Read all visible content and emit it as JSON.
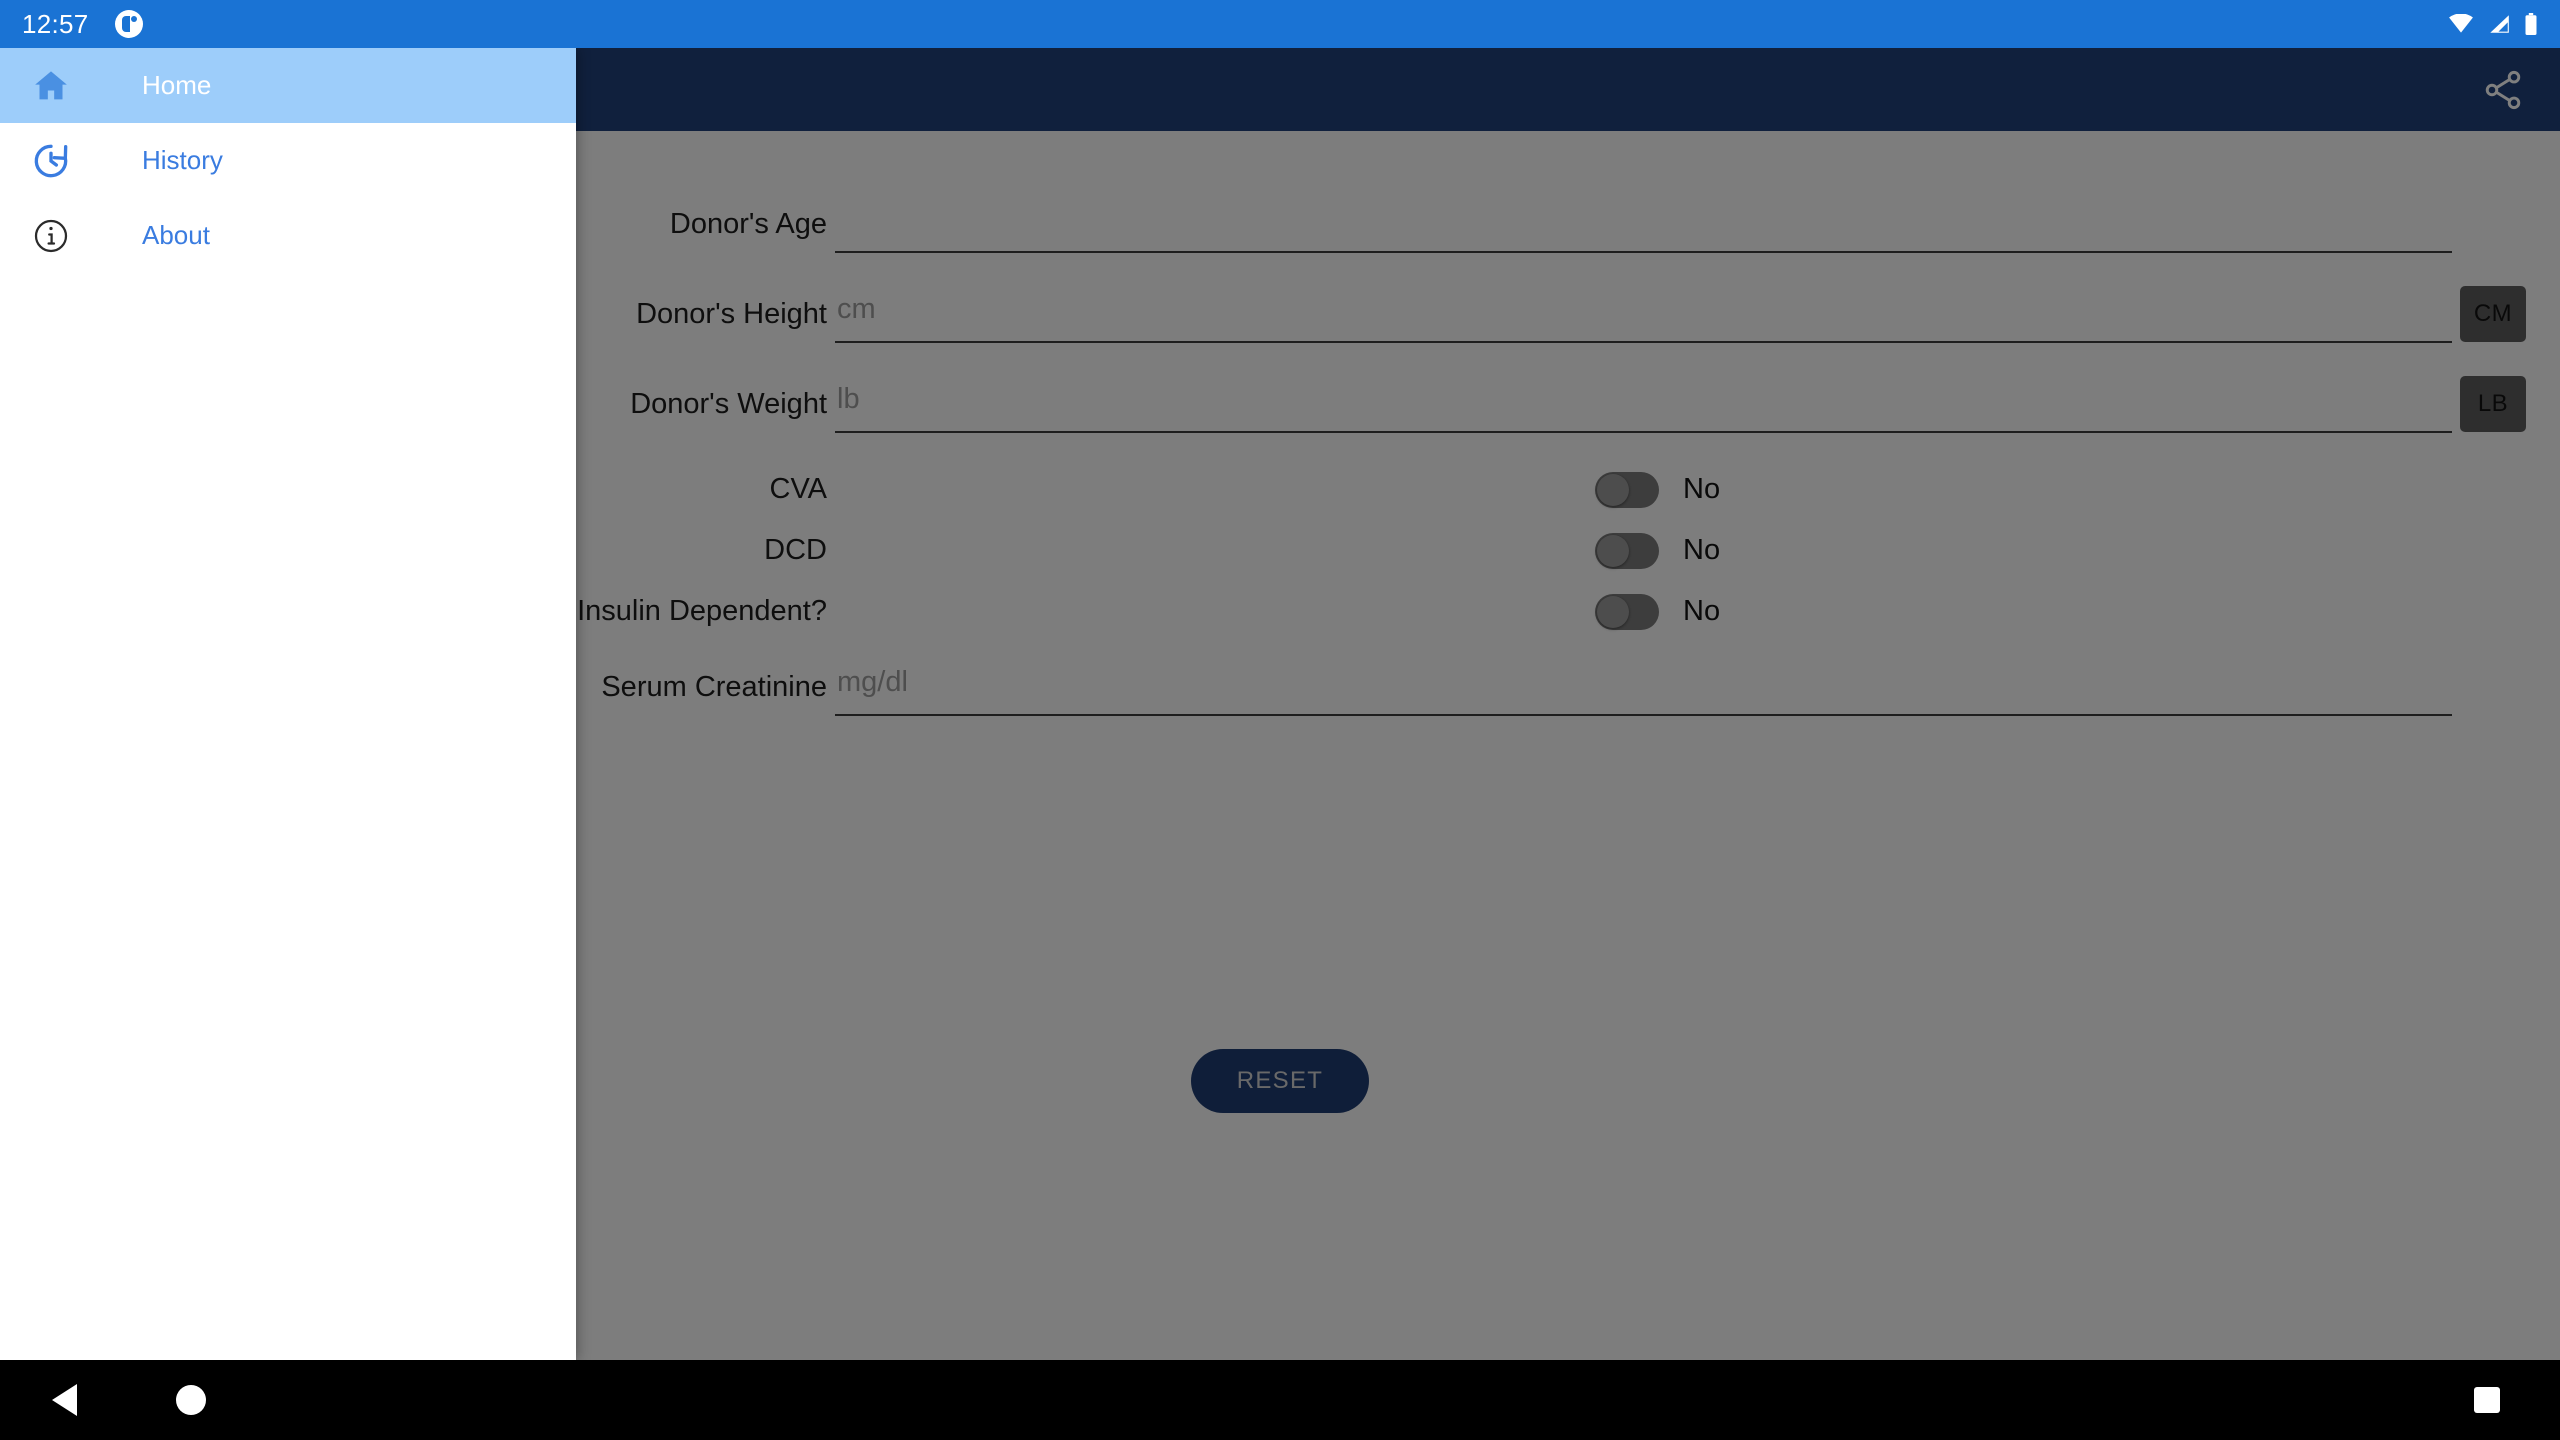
{
  "status_bar": {
    "clock": "12:57",
    "app_icon": "app-logo-icon",
    "icons": [
      "wifi-icon",
      "cellular-signal-icon",
      "battery-icon"
    ]
  },
  "app_bar": {
    "title": "",
    "share_icon": "share-icon"
  },
  "drawer": {
    "items": [
      {
        "label": "Home",
        "icon": "home-icon",
        "selected": true
      },
      {
        "label": "History",
        "icon": "history-icon",
        "selected": false
      },
      {
        "label": "About",
        "icon": "info-icon",
        "selected": false
      }
    ]
  },
  "form": {
    "fields": [
      {
        "label": "Donor's Age",
        "value": "",
        "placeholder": "",
        "unit_button": null
      },
      {
        "label": "Donor's Height",
        "value": "",
        "placeholder": "cm",
        "unit_button": "CM"
      },
      {
        "label": "Donor's Weight",
        "value": "",
        "placeholder": "lb",
        "unit_button": "LB"
      }
    ],
    "switches": [
      {
        "label": "CVA",
        "value": "No",
        "on": false
      },
      {
        "label": "DCD",
        "value": "No",
        "on": false
      },
      {
        "label": "Insulin Dependent?",
        "value": "No",
        "on": false
      }
    ],
    "creatinine": {
      "label": "Serum Creatinine",
      "value": "",
      "placeholder": "mg/dl"
    },
    "reset_label": "RESET"
  },
  "nav_bar": {
    "back": "back-triangle-icon",
    "home": "home-circle-icon",
    "recents": "recents-square-icon"
  },
  "colors": {
    "status_bar": "#1a73d4",
    "app_bar": "#21417a",
    "drawer_selected": "#9dcdfa",
    "accent": "#3a7ce0",
    "reset_button": "#1f3d72"
  }
}
